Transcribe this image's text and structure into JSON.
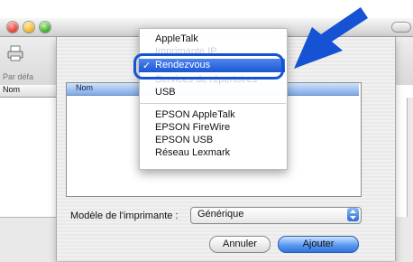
{
  "back_window": {
    "default_label": "Par défa",
    "column_nom": "Nom"
  },
  "sheet": {
    "list_header": "Nom",
    "model_label": "Modèle de l'imprimante :",
    "model_value": "Générique",
    "cancel_label": "Annuler",
    "add_label": "Ajouter"
  },
  "menu": {
    "items": [
      "AppleTalk",
      "Imprimante IP",
      "Rendezvous",
      "Services de répertoires",
      "USB",
      "EPSON AppleTalk",
      "EPSON FireWire",
      "EPSON USB",
      "Réseau Lexmark"
    ],
    "selected_mark": "✓"
  },
  "colors": {
    "selection_blue": "#1c57d2",
    "callout_blue": "#1553d4"
  }
}
